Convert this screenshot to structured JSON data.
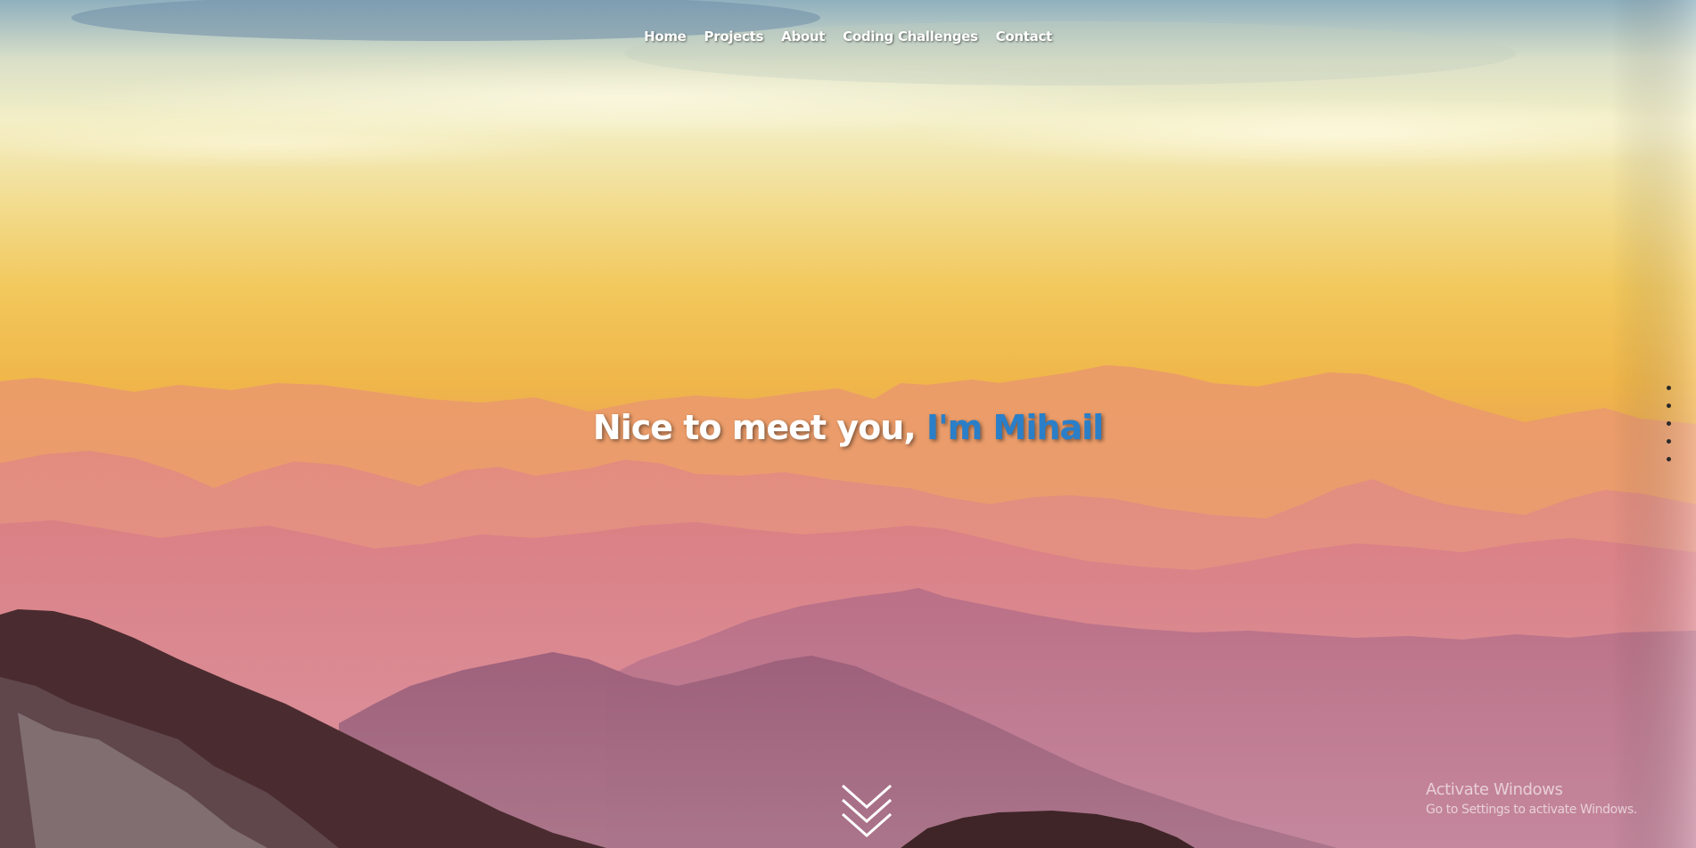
{
  "nav": {
    "items": [
      {
        "label": "Home"
      },
      {
        "label": "Projects"
      },
      {
        "label": "About"
      },
      {
        "label": "Coding Challenges"
      },
      {
        "label": "Contact"
      }
    ]
  },
  "hero": {
    "greeting": "Nice to meet you, ",
    "name": "I'm Mihail",
    "name_color": "#2a7fc8"
  },
  "section_dots": {
    "count": 5,
    "color": "#2a2a2a"
  },
  "scroll_indicator": {
    "icon": "chevron-double-down-icon"
  },
  "os_overlay": {
    "title": "Activate Windows",
    "subtitle": "Go to Settings to activate Windows."
  },
  "colors": {
    "sky_top": "#8fb3c4",
    "sky_mid": "#f5efc5",
    "sky_gold": "#f2bf47",
    "haze_pink": "#e79a8a",
    "mountain_dark": "#4a2a2e"
  }
}
